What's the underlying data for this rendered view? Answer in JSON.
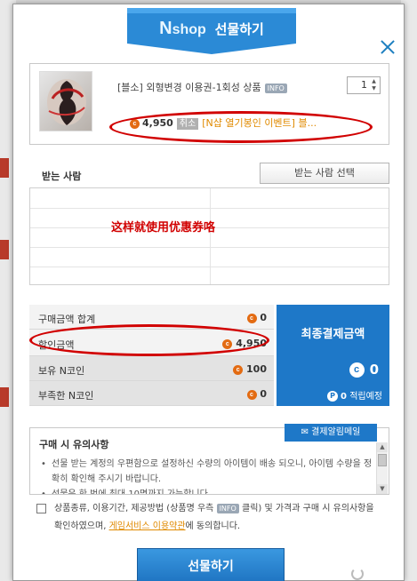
{
  "dialog": {
    "logo": "N",
    "logo_rest": "shop",
    "title": "선물하기"
  },
  "product": {
    "name": "[블소] 외형변경 이용권-1회성 상품",
    "info_badge": "INFO",
    "quantity": "1",
    "coin_symbol": "c",
    "price": "4,950",
    "cancel_label": "취소",
    "event_text": "[N샵 열기봉인 이벤트] 블..."
  },
  "recipients": {
    "title": "받는 사람",
    "select_button": "받는 사람 선택"
  },
  "annotation": "这样就使用优惠券咯",
  "payment": {
    "rows": [
      {
        "label": "구매금액 합계",
        "value": "0"
      },
      {
        "label": "할인금액",
        "value": "4,950"
      },
      {
        "label": "보유 N코인",
        "value": "100"
      },
      {
        "label": "부족한 N코인",
        "value": "0"
      }
    ],
    "final_title": "최종결제금액",
    "final_amount": "0",
    "points_icon": "P",
    "points_value": "0",
    "points_label": "적립예정"
  },
  "notes": {
    "tab_label": "결제알림메일",
    "title": "구매 시 유의사항",
    "items": [
      "선물 받는 계정의 우편함으로 설정하신 수량의 아이템이 배송 되오니, 아이템 수량을 정확히 확인해 주시기 바랍니다.",
      "선물은 한 번에 최대 10명까지 가능합니다."
    ]
  },
  "agreement": {
    "text_before": "상품종류, 이용기간, 제공방법 (상품명 우측 ",
    "info_badge": "INFO",
    "text_middle": " 클릭) 및 가격과 구매 시 유의사항을 확인하였으며, ",
    "link": "게임서비스 이용약관",
    "text_after": "에 동의합니다."
  },
  "actions": {
    "gift_button": "선물하기"
  },
  "colors": {
    "accent_blue": "#1e78c8",
    "coin_orange": "#e36b12",
    "highlight_red": "#d10000"
  }
}
